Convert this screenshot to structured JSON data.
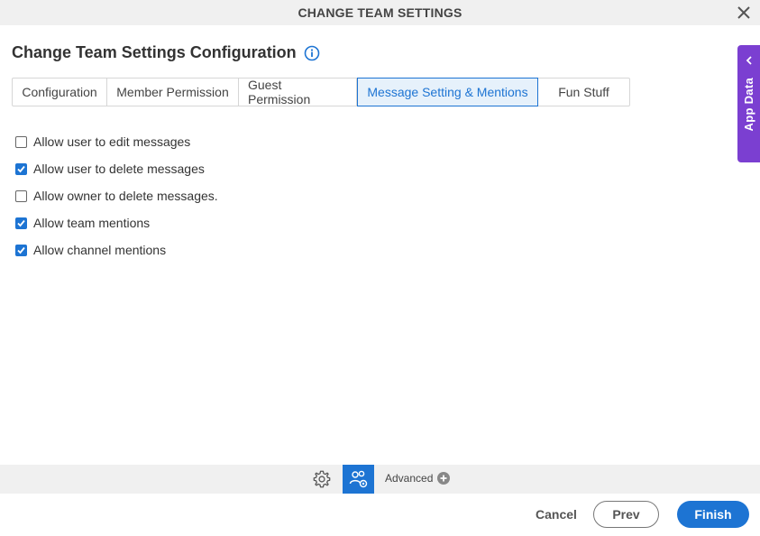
{
  "window": {
    "title": "CHANGE TEAM SETTINGS"
  },
  "heading": {
    "title": "Change Team Settings Configuration"
  },
  "tabs": [
    {
      "label": "Configuration",
      "active": false
    },
    {
      "label": "Member Permission",
      "active": false
    },
    {
      "label": "Guest Permission",
      "active": false
    },
    {
      "label": "Message Setting & Mentions",
      "active": true
    },
    {
      "label": "Fun Stuff",
      "active": false
    }
  ],
  "options": [
    {
      "label": "Allow user to edit messages",
      "checked": false
    },
    {
      "label": "Allow user to delete messages",
      "checked": true
    },
    {
      "label": "Allow owner to delete messages.",
      "checked": false
    },
    {
      "label": "Allow team mentions",
      "checked": true
    },
    {
      "label": "Allow channel mentions",
      "checked": true
    }
  ],
  "side_panel": {
    "label": "App Data"
  },
  "bottom_bar": {
    "advanced_label": "Advanced"
  },
  "footer": {
    "cancel": "Cancel",
    "prev": "Prev",
    "finish": "Finish"
  },
  "colors": {
    "accent": "#1d74d3",
    "side_panel": "#7b3fd1",
    "bar_bg": "#f0f0f0"
  }
}
